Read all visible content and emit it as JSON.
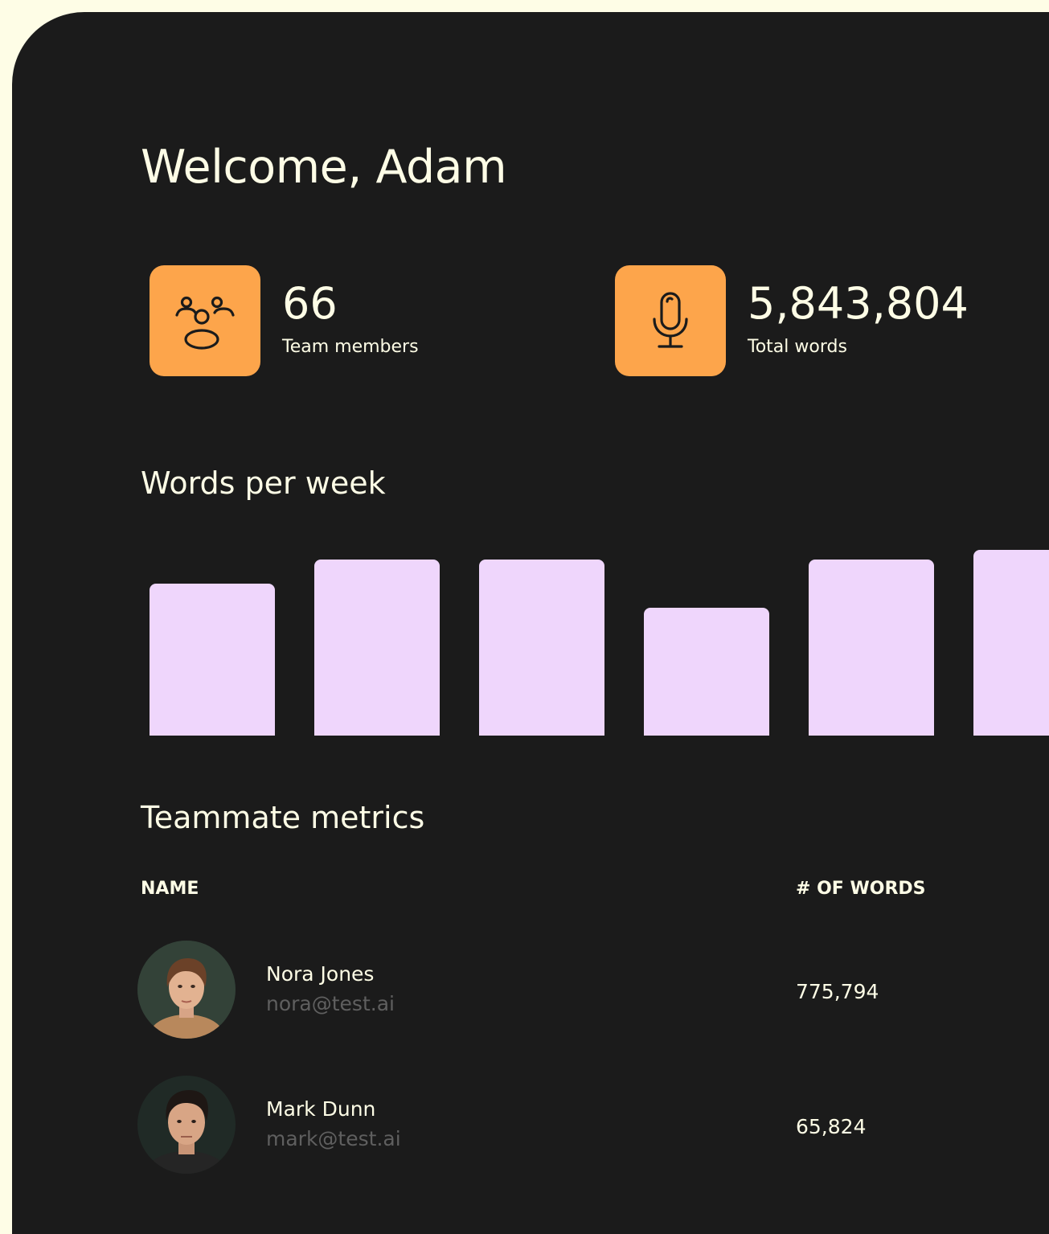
{
  "header": {
    "welcome": "Welcome, Adam"
  },
  "stats": [
    {
      "icon": "team-members-icon",
      "value": "66",
      "label": "Team members"
    },
    {
      "icon": "microphone-icon",
      "value": "5,843,804",
      "label": "Total words"
    }
  ],
  "chart_section": {
    "title": "Words per week"
  },
  "chart_data": {
    "type": "bar",
    "title": "Words per week",
    "relative_values": [
      0.82,
      0.95,
      0.95,
      0.69,
      0.95,
      1.0
    ],
    "grid": false,
    "legend": "none"
  },
  "metrics": {
    "title": "Teammate metrics",
    "columns": {
      "name": "NAME",
      "words": "# OF WORDS"
    },
    "rows": [
      {
        "name": "Nora Jones",
        "email": "nora@test.ai",
        "words": "775,794"
      },
      {
        "name": "Mark Dunn",
        "email": "mark@test.ai",
        "words": "65,824"
      }
    ]
  },
  "colors": {
    "background": "#fefde6",
    "panel": "#1b1b1b",
    "accent": "#fda54b",
    "bar": "#efd6fc",
    "text": "#fefde6",
    "muted_text": "#5f5f5f"
  }
}
